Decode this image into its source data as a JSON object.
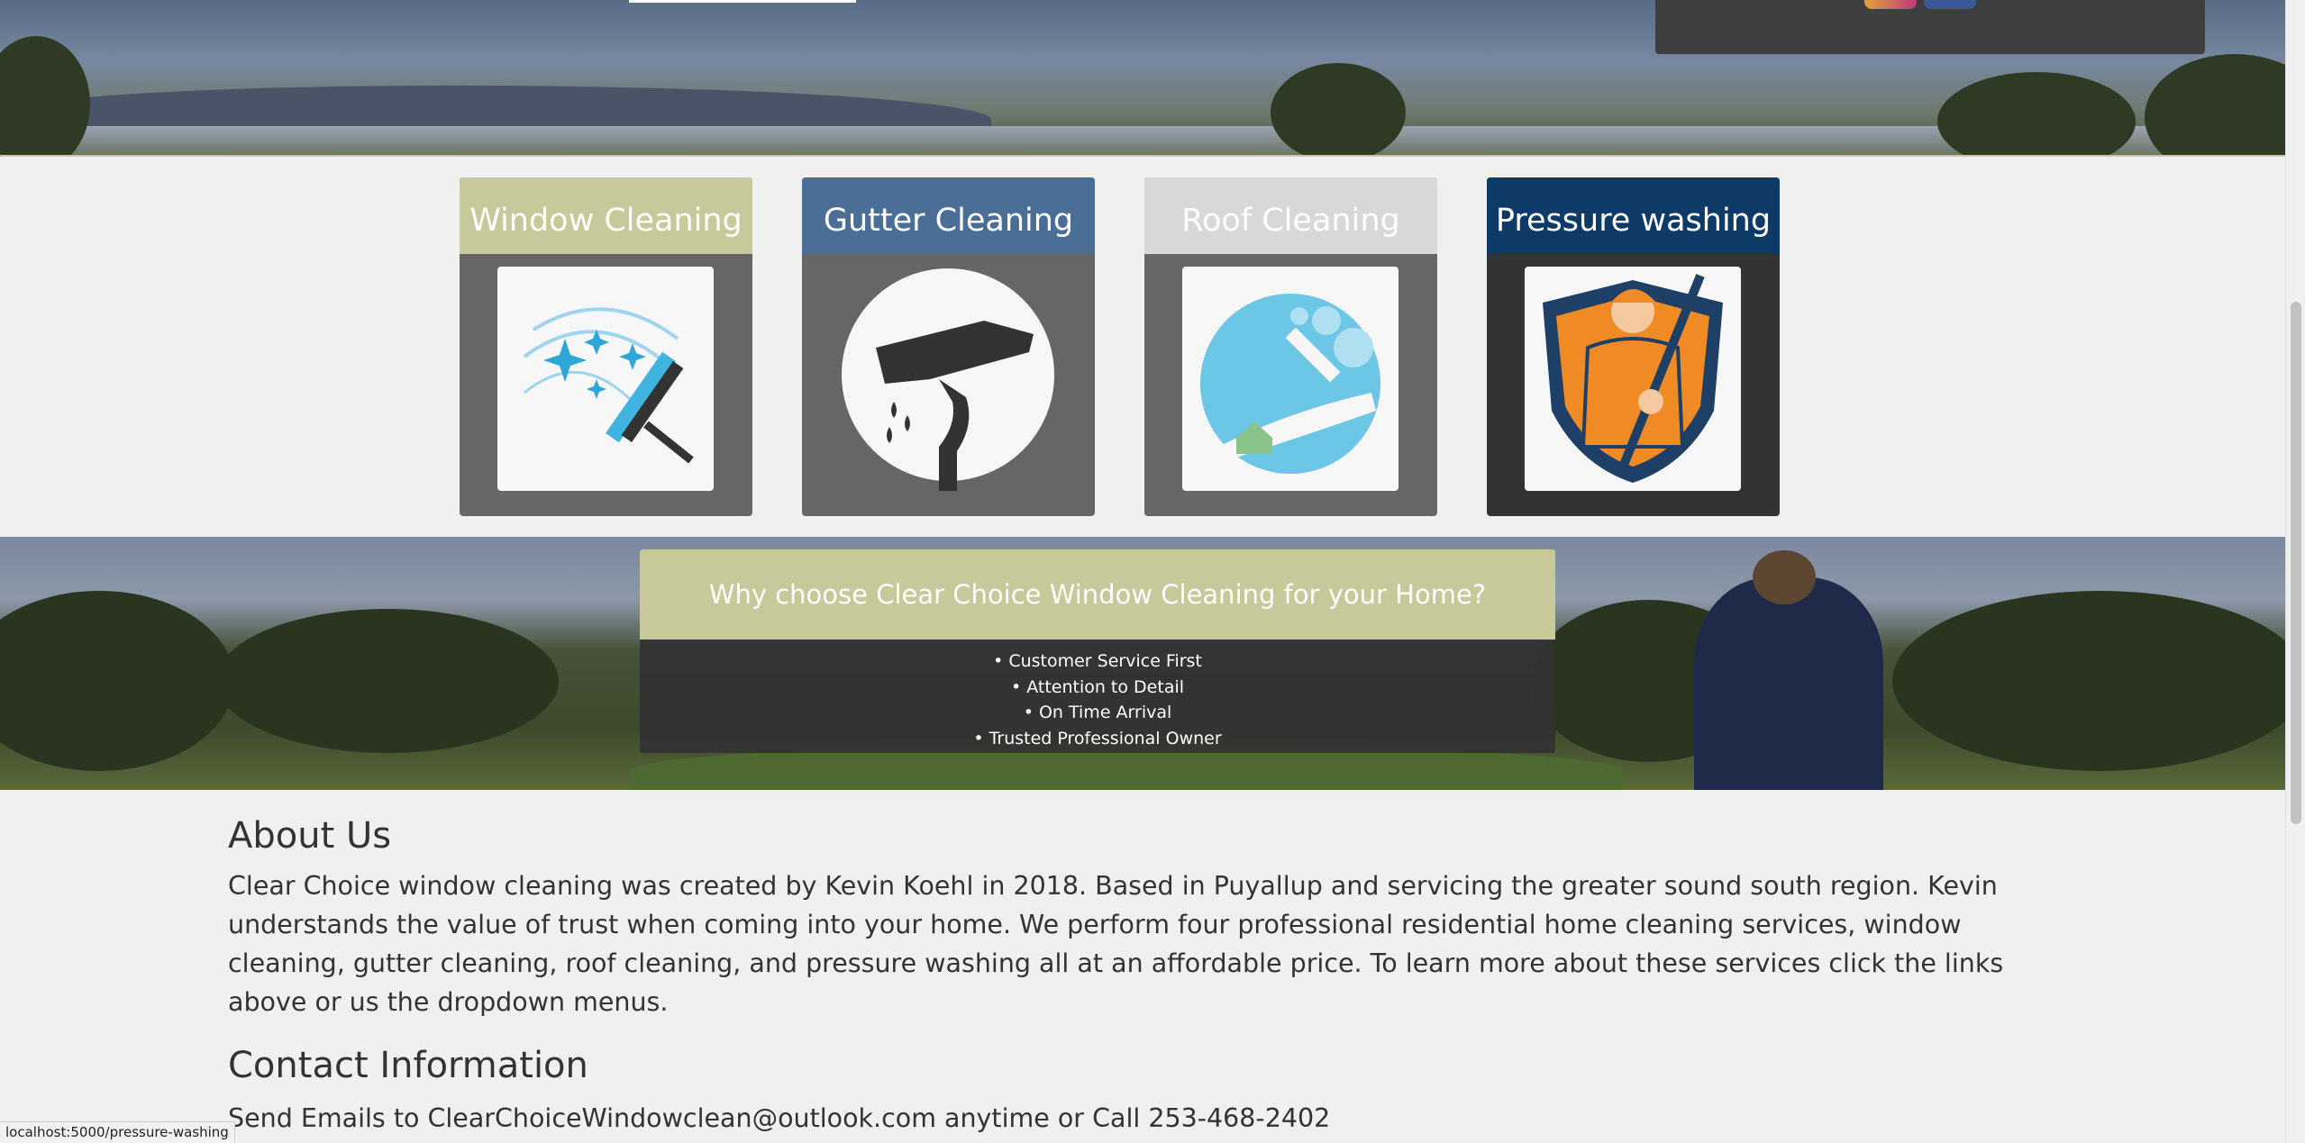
{
  "services": [
    {
      "label": "Window Cleaning",
      "header_color": "#c8c99a",
      "body_color": "#666666"
    },
    {
      "label": "Gutter Cleaning",
      "header_color": "#4a6e96",
      "body_color": "#666666"
    },
    {
      "label": "Roof Cleaning",
      "header_color": "#d8d8d8",
      "body_color": "#666666"
    },
    {
      "label": "Pressure washing",
      "header_color": "#0d3a66",
      "body_color": "#333333"
    }
  ],
  "why": {
    "title": "Why choose Clear Choice Window Cleaning for your Home?",
    "items": [
      "Customer Service First",
      "Attention to Detail",
      "On Time Arrival",
      "Trusted Professional Owner"
    ]
  },
  "about": {
    "title": "About Us",
    "body": "Clear Choice window cleaning was created by Kevin Koehl in 2018. Based in Puyallup and servicing the greater sound south region. Kevin understands the value of trust when coming into your home. We perform four professional residential home cleaning services, window cleaning, gutter cleaning, roof cleaning, and pressure washing all at an affordable price. To learn more about these services click the links above or us the dropdown menus."
  },
  "contact": {
    "title": "Contact Information",
    "line": "Send Emails to ClearChoiceWindowclean@outlook.com anytime or Call 253-468-2402"
  },
  "status_bar": {
    "url": "localhost:5000/pressure-washing"
  },
  "icons": {
    "social": [
      "instagram-icon",
      "facebook-icon"
    ],
    "cards": [
      "window-squeegee-icon",
      "gutter-icon",
      "roof-cleaning-icon",
      "pressure-washer-man-icon"
    ]
  },
  "colors": {
    "accent": "#c8c99a",
    "panel_dark": "#333333",
    "card_gray": "#666666"
  }
}
